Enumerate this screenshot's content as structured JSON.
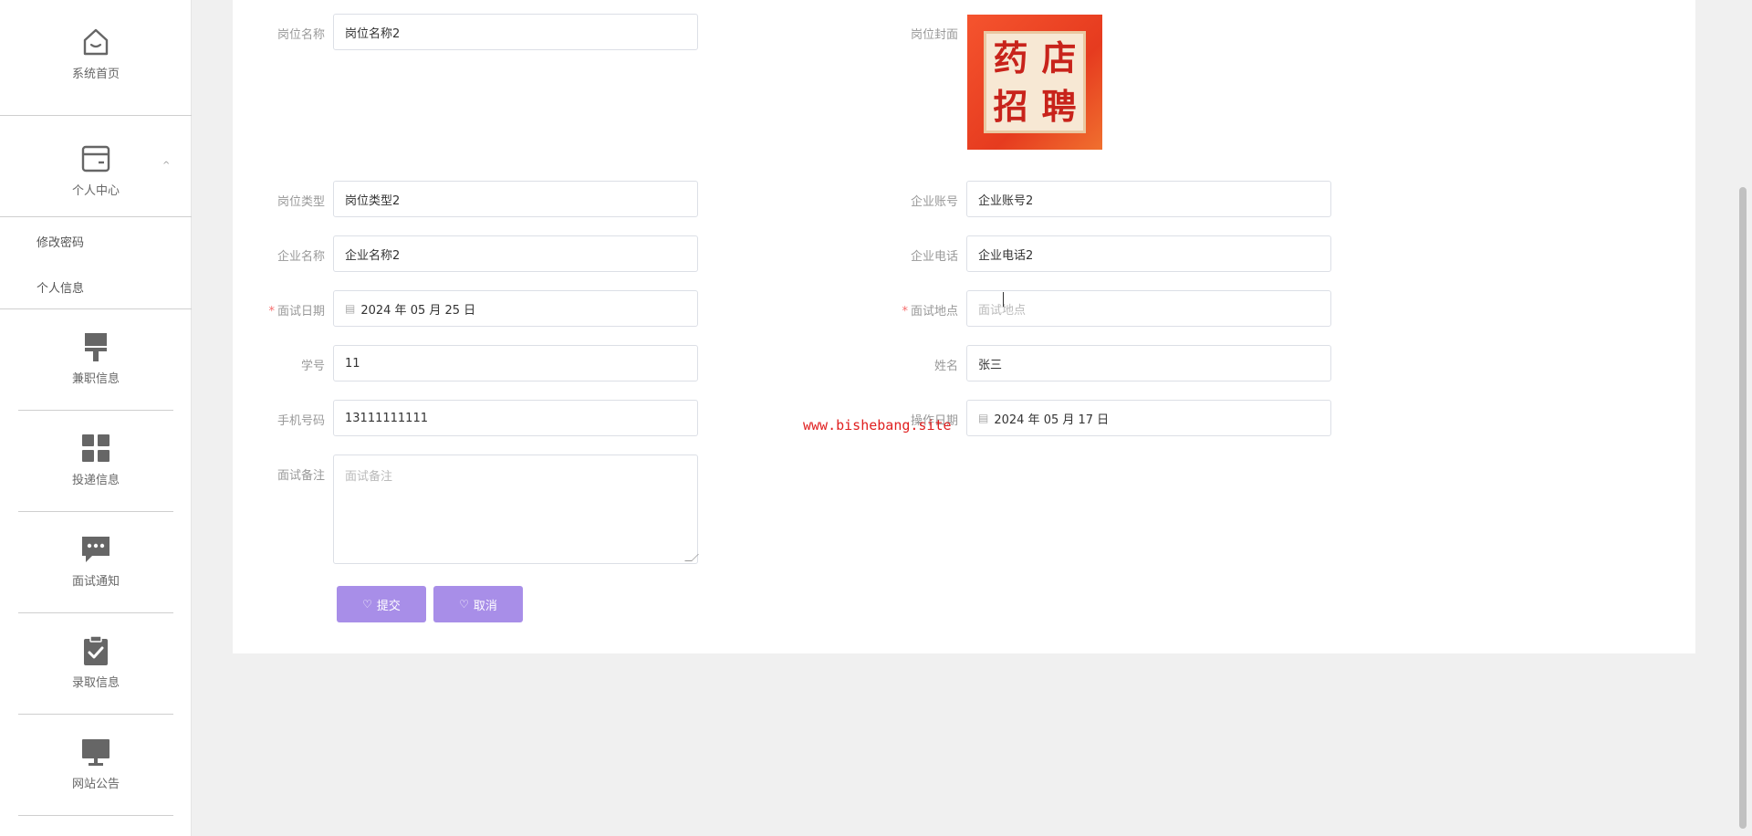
{
  "sidebar": {
    "items": [
      {
        "label": "系统首页",
        "icon": "home-icon"
      },
      {
        "label": "个人中心",
        "icon": "wallet-icon"
      },
      {
        "label": "兼职信息",
        "icon": "brush-icon"
      },
      {
        "label": "投递信息",
        "icon": "grid-icon"
      },
      {
        "label": "面试通知",
        "icon": "chat-icon"
      },
      {
        "label": "录取信息",
        "icon": "clipboard-check-icon"
      },
      {
        "label": "网站公告",
        "icon": "monitor-icon"
      }
    ],
    "sub_items": [
      {
        "label": "修改密码"
      },
      {
        "label": "个人信息"
      }
    ]
  },
  "form": {
    "job_name": {
      "label": "岗位名称",
      "value": "岗位名称2"
    },
    "job_cover": {
      "label": "岗位封面",
      "image_text": [
        "药",
        "店",
        "招",
        "聘"
      ]
    },
    "job_type": {
      "label": "岗位类型",
      "value": "岗位类型2"
    },
    "company_account": {
      "label": "企业账号",
      "value": "企业账号2"
    },
    "company_name": {
      "label": "企业名称",
      "value": "企业名称2"
    },
    "company_phone": {
      "label": "企业电话",
      "value": "企业电话2"
    },
    "interview_date": {
      "label": "面试日期",
      "required_mark": "*",
      "value": "2024 年 05 月 25 日"
    },
    "interview_place": {
      "label": "面试地点",
      "required_mark": "*",
      "placeholder": "面试地点"
    },
    "student_id": {
      "label": "学号",
      "value": "11"
    },
    "name": {
      "label": "姓名",
      "value": "张三"
    },
    "phone": {
      "label": "手机号码",
      "value": "13111111111"
    },
    "operate_date": {
      "label": "操作日期",
      "value": "2024 年 05 月 17 日"
    },
    "remark": {
      "label": "面试备注",
      "placeholder": "面试备注"
    }
  },
  "buttons": {
    "submit": "提交",
    "cancel": "取消"
  },
  "watermark": "www.bishebang.site",
  "colors": {
    "button": "#a88ee8",
    "required": "#f56c6c",
    "watermark": "#e02020"
  }
}
